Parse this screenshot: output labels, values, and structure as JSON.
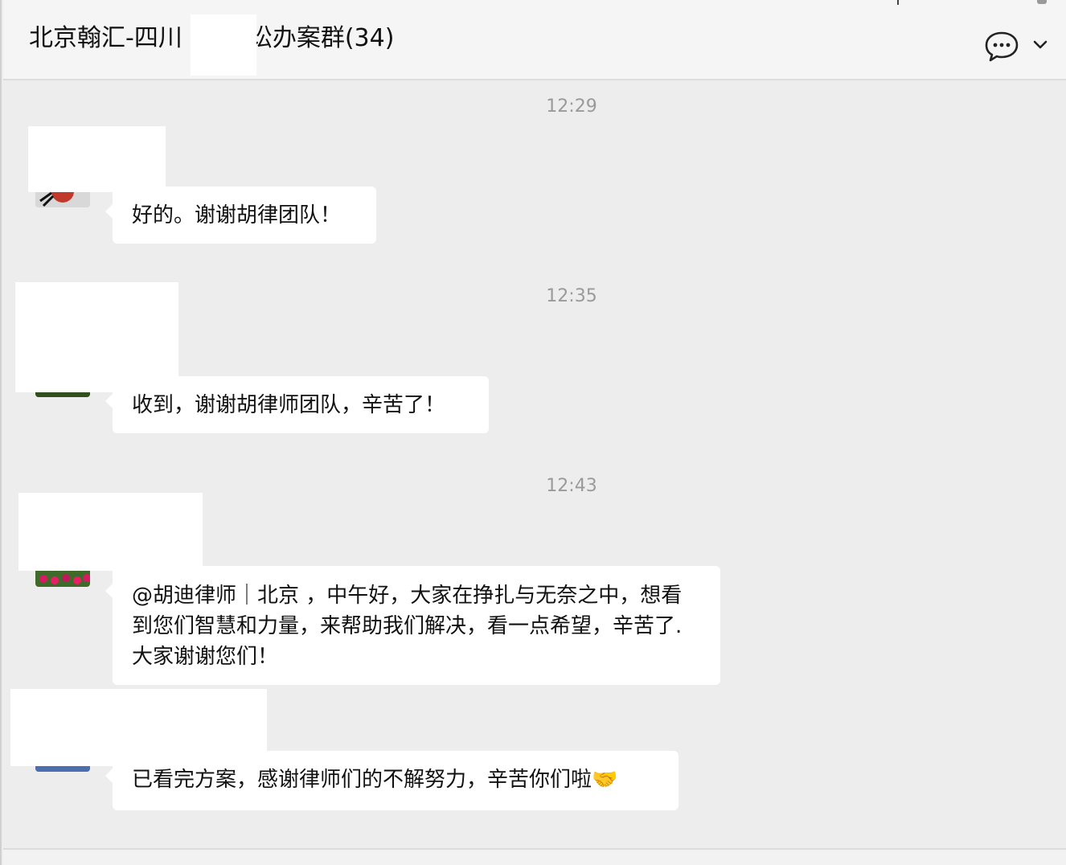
{
  "header": {
    "title": "北京翰汇-四川   诉讼办案群(34)",
    "title_prefix": "北京翰汇-四川",
    "title_suffix": "诉讼办案群(34)",
    "chat_icon": "chat-bubble-icon",
    "menu_icon": "chevron-down-icon"
  },
  "messages": [
    {
      "time": "12:29",
      "text": "好的。谢谢胡律团队！"
    },
    {
      "time": "12:35",
      "text": "收到，谢谢胡律师团队，辛苦了！"
    },
    {
      "time": "12:43",
      "text": "@胡迪律师｜北京 ，中午好，大家在挣扎与无奈之中，想看到您们智慧和力量，来帮助我们解决，看一点希望，辛苦了.大家谢谢您们！"
    },
    {
      "time": "",
      "text": "已看完方案，感谢律师们的不解努力，辛苦你们啦🤝"
    }
  ],
  "colors": {
    "background": "#ededed",
    "bubble": "#ffffff",
    "timestamp": "#9a9a9a",
    "text": "#111111"
  }
}
